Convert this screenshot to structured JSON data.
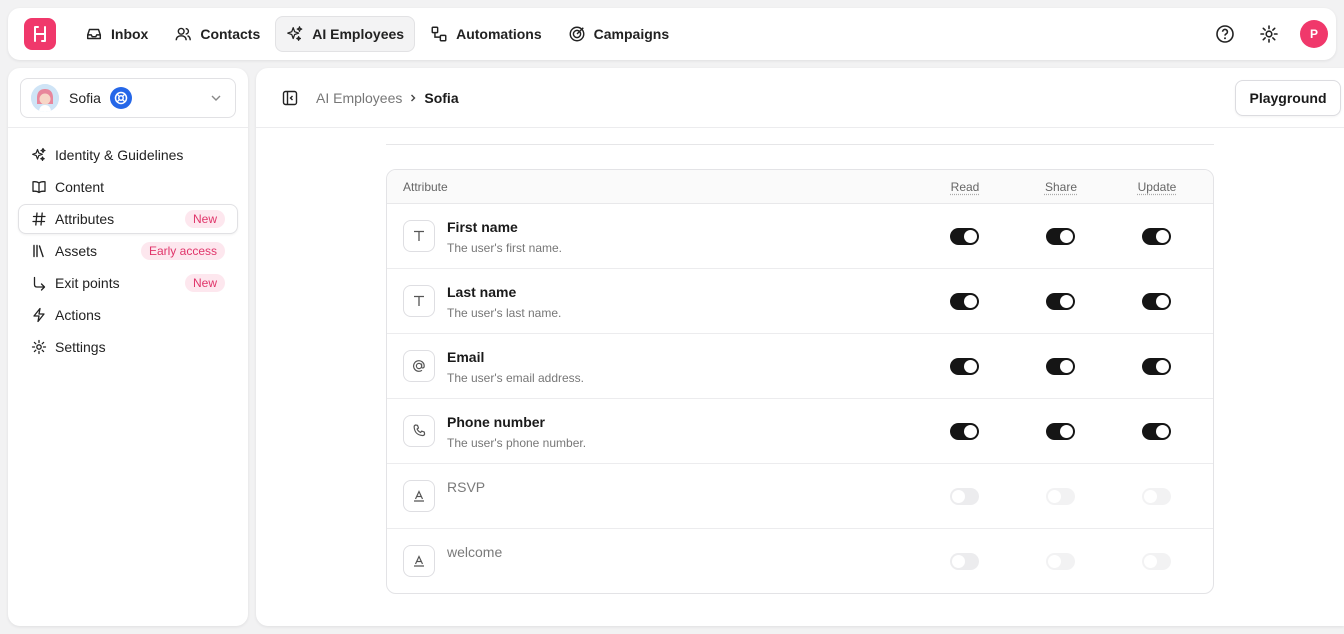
{
  "topbar": {
    "nav": [
      {
        "label": "Inbox",
        "icon": "inbox-icon"
      },
      {
        "label": "Contacts",
        "icon": "users-icon"
      },
      {
        "label": "AI Employees",
        "icon": "sparkles-icon",
        "active": true
      },
      {
        "label": "Automations",
        "icon": "workflow-icon"
      },
      {
        "label": "Campaigns",
        "icon": "target-icon"
      }
    ],
    "user_initial": "P",
    "brand_color": "#f0386b"
  },
  "sidebar": {
    "agent_name": "Sofia",
    "items": [
      {
        "label": "Identity & Guidelines",
        "icon": "sparkles-icon",
        "badge": ""
      },
      {
        "label": "Content",
        "icon": "book-icon",
        "badge": ""
      },
      {
        "label": "Attributes",
        "icon": "hash-icon",
        "badge": "New",
        "active": true
      },
      {
        "label": "Assets",
        "icon": "library-icon",
        "badge": "Early access"
      },
      {
        "label": "Exit points",
        "icon": "corner-arrow-icon",
        "badge": "New"
      },
      {
        "label": "Actions",
        "icon": "bolt-icon",
        "badge": ""
      },
      {
        "label": "Settings",
        "icon": "gear-icon",
        "badge": ""
      }
    ]
  },
  "main": {
    "breadcrumb": {
      "parent": "AI Employees",
      "current": "Sofia"
    },
    "playground_label": "Playground",
    "table": {
      "headers": {
        "attribute": "Attribute",
        "read": "Read",
        "share": "Share",
        "update": "Update"
      },
      "rows": [
        {
          "name": "First name",
          "desc": "The user's first name.",
          "icon": "text-icon",
          "read": true,
          "share": true,
          "update": true,
          "enabled": true
        },
        {
          "name": "Last name",
          "desc": "The user's last name.",
          "icon": "text-icon",
          "read": true,
          "share": true,
          "update": true,
          "enabled": true
        },
        {
          "name": "Email",
          "desc": "The user's email address.",
          "icon": "at-icon",
          "read": true,
          "share": true,
          "update": true,
          "enabled": true
        },
        {
          "name": "Phone number",
          "desc": "The user's phone number.",
          "icon": "phone-icon",
          "read": true,
          "share": true,
          "update": true,
          "enabled": true
        },
        {
          "name": "RSVP",
          "desc": "",
          "icon": "custom-text-icon",
          "read": false,
          "share": false,
          "update": false,
          "enabled": false
        },
        {
          "name": "welcome",
          "desc": "",
          "icon": "custom-text-icon",
          "read": false,
          "share": false,
          "update": false,
          "enabled": false
        }
      ]
    }
  }
}
